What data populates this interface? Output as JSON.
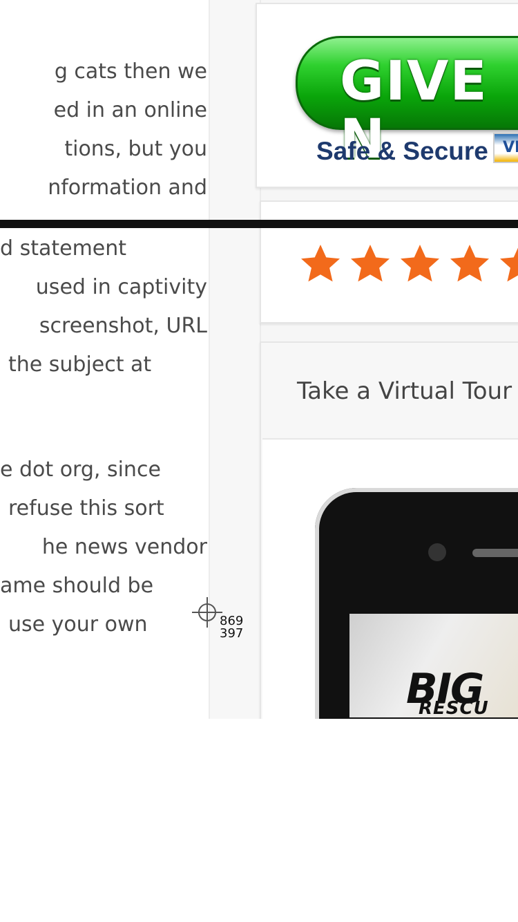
{
  "article_lines": [
    "g cats then we",
    "ed in an online",
    "tions, but you",
    "nformation and",
    "d statement",
    "used in captivity",
    "screenshot, URL",
    "the subject at",
    "e dot org, since",
    "refuse this sort",
    "he news vendor",
    "ame should be",
    "use your own"
  ],
  "donate_banner": {
    "button_label": "GIVE N",
    "secure_label": "Safe & Secure",
    "card_label": "VI"
  },
  "rating": {
    "stars": 5,
    "shown_stars": 5,
    "star_color": "#f26a1b"
  },
  "tour": {
    "label": "Take a Virtual Tour"
  },
  "phone_app": {
    "brand": "BIG C",
    "brand_sub": "RESCU"
  },
  "cursor_readout": {
    "x": "869",
    "y": "397"
  },
  "colors": {
    "text": "#4a4a4a",
    "donate_green": "#0aa50a",
    "secure_blue": "#1e3a6e"
  }
}
